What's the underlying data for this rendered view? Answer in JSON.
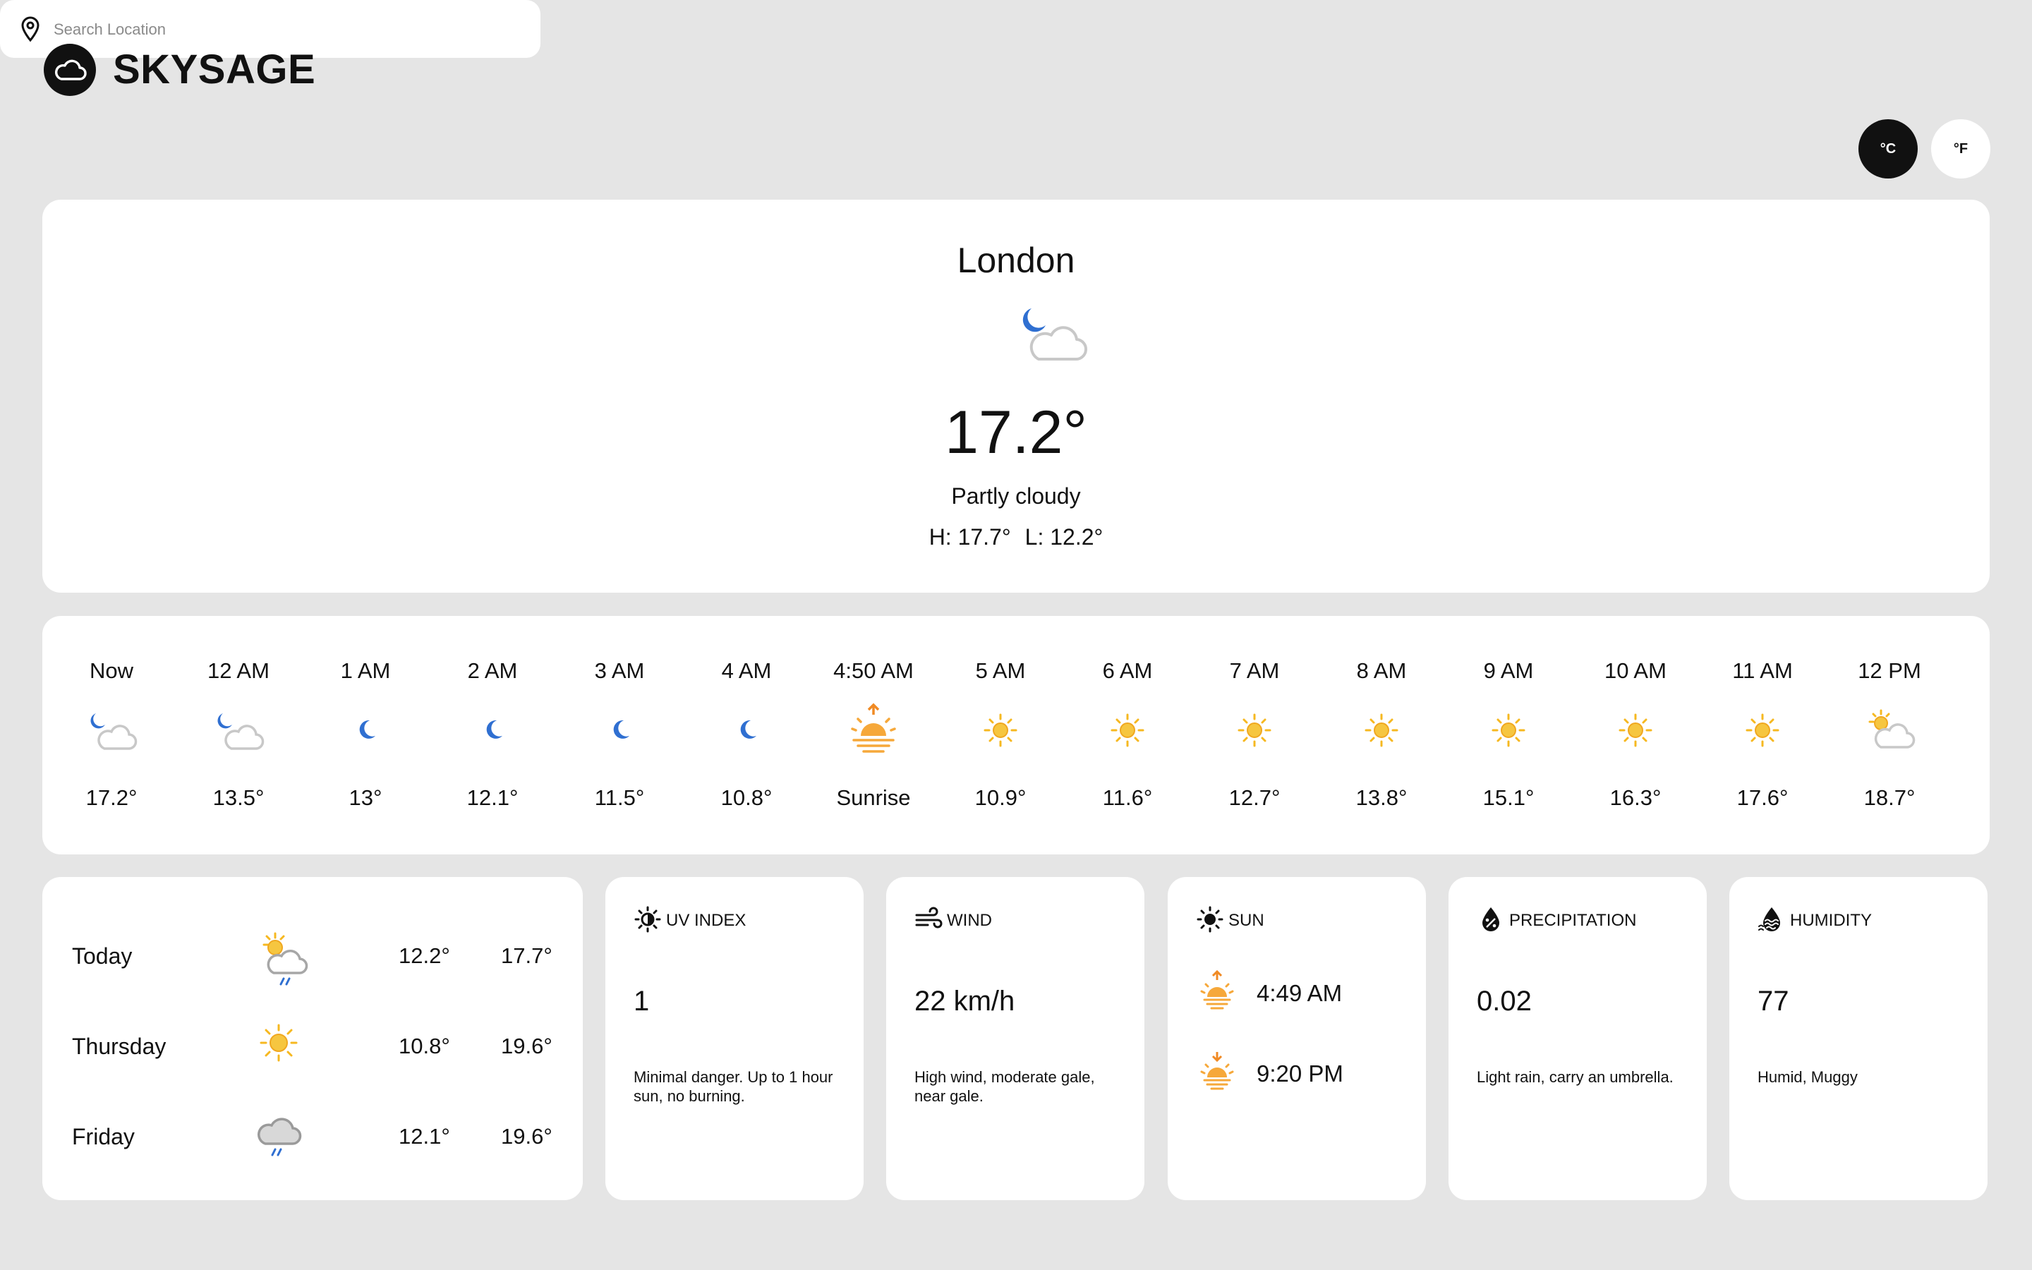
{
  "app": {
    "name": "SKYSAGE"
  },
  "search": {
    "placeholder": "Search Location"
  },
  "units": {
    "celsius": "°C",
    "fahrenheit": "°F",
    "selected": "°C"
  },
  "current": {
    "city": "London",
    "icon": "partly-cloudy-night-icon",
    "temp": "17.2°",
    "condition": "Partly cloudy",
    "high": "H: 17.7°",
    "low": "L: 12.2°"
  },
  "hourly": [
    {
      "time": "Now",
      "icon": "partly-cloudy-night",
      "value": "17.2°"
    },
    {
      "time": "12 AM",
      "icon": "partly-cloudy-night",
      "value": "13.5°"
    },
    {
      "time": "1 AM",
      "icon": "moon",
      "value": "13°"
    },
    {
      "time": "2 AM",
      "icon": "moon",
      "value": "12.1°"
    },
    {
      "time": "3 AM",
      "icon": "moon",
      "value": "11.5°"
    },
    {
      "time": "4 AM",
      "icon": "moon",
      "value": "10.8°"
    },
    {
      "time": "4:50 AM",
      "icon": "sunrise",
      "value": "Sunrise"
    },
    {
      "time": "5 AM",
      "icon": "sun",
      "value": "10.9°"
    },
    {
      "time": "6 AM",
      "icon": "sun",
      "value": "11.6°"
    },
    {
      "time": "7 AM",
      "icon": "sun",
      "value": "12.7°"
    },
    {
      "time": "8 AM",
      "icon": "sun",
      "value": "13.8°"
    },
    {
      "time": "9 AM",
      "icon": "sun",
      "value": "15.1°"
    },
    {
      "time": "10 AM",
      "icon": "sun",
      "value": "16.3°"
    },
    {
      "time": "11 AM",
      "icon": "sun",
      "value": "17.6°"
    },
    {
      "time": "12 PM",
      "icon": "partly-cloudy-day",
      "value": "18.7°"
    }
  ],
  "forecast": [
    {
      "day": "Today",
      "icon": "partly-cloudy-rain",
      "low": "12.2°",
      "high": "17.7°"
    },
    {
      "day": "Thursday",
      "icon": "sun",
      "low": "10.8°",
      "high": "19.6°"
    },
    {
      "day": "Friday",
      "icon": "cloud-rain",
      "low": "12.1°",
      "high": "19.6°"
    }
  ],
  "uv": {
    "label": "UV INDEX",
    "icon": "uv-sun-icon",
    "value": "1",
    "desc": "Minimal danger. Up to 1 hour sun, no burning."
  },
  "wind": {
    "label": "WIND",
    "icon": "wind-icon",
    "value": "22 km/h",
    "desc": "High wind, moderate gale, near gale."
  },
  "sun": {
    "label": "SUN",
    "icon": "sun-icon",
    "sunrise": "4:49 AM",
    "sunset": "9:20 PM"
  },
  "precipitation": {
    "label": "PRECIPITATION",
    "icon": "droplet-percent-icon",
    "value": "0.02",
    "desc": "Light rain, carry an umbrella."
  },
  "humidity": {
    "label": "HUMIDITY",
    "icon": "humidity-icon",
    "value": "77",
    "desc": "Humid, Muggy"
  },
  "colors": {
    "background": "#e5e5e5",
    "card": "#ffffff",
    "accent": "#111111",
    "moon": "#2f6fd1",
    "sun": "#f6b820",
    "sunrise": "#f08a24"
  }
}
